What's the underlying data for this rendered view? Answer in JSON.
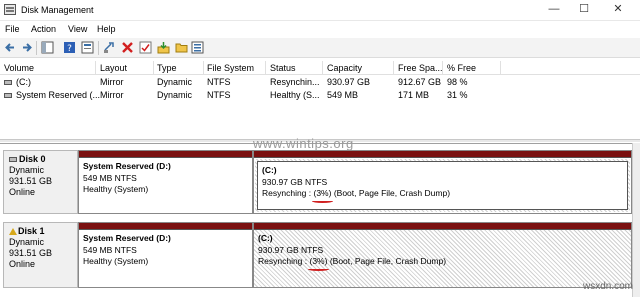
{
  "window": {
    "title": "Disk Management",
    "controls": {
      "minimize": "—",
      "maximize": "☐",
      "close": "✕"
    }
  },
  "menu": [
    "File",
    "Action",
    "View",
    "Help"
  ],
  "toolbar": [
    "back-icon",
    "forward-icon",
    "console-tree-icon",
    "help-icon",
    "properties-icon",
    "connect-icon",
    "delete-icon",
    "check-icon",
    "import-icon",
    "folder-icon",
    "list-icon"
  ],
  "volumes": {
    "columns": [
      "Volume",
      "Layout",
      "Type",
      "File System",
      "Status",
      "Capacity",
      "Free Spa...",
      "% Free"
    ],
    "rows": [
      [
        "(C:)",
        "Mirror",
        "Dynamic",
        "NTFS",
        "Resynchin...",
        "930.97 GB",
        "912.67 GB",
        "98 %"
      ],
      [
        "System Reserved (...",
        "Mirror",
        "Dynamic",
        "NTFS",
        "Healthy (S...",
        "549 MB",
        "171 MB",
        "31 %"
      ]
    ]
  },
  "watermark": "www.wintips.org",
  "disks": [
    {
      "name": "Disk 0",
      "type": "Dynamic",
      "size": "931.51 GB",
      "state": "Online",
      "warning": false,
      "partitions": [
        {
          "title": "System Reserved  (D:)",
          "line1": "549 MB NTFS",
          "line2": "Healthy (System)"
        },
        {
          "title": "(C:)",
          "line1": "930.97 GB NTFS",
          "line2_prefix": "Resynching : ",
          "line2_mark": "(3%)",
          "line2_suffix": " (Boot, Page File, Crash Dump)"
        }
      ]
    },
    {
      "name": "Disk 1",
      "type": "Dynamic",
      "size": "931.51 GB",
      "state": "Online",
      "warning": true,
      "partitions": [
        {
          "title": "System Reserved  (D:)",
          "line1": "549 MB NTFS",
          "line2": "Healthy (System)"
        },
        {
          "title": "(C:)",
          "line1": "930.97 GB NTFS",
          "line2_prefix": "Resynching : ",
          "line2_mark": "(3%)",
          "line2_suffix": " (Boot, Page File, Crash Dump)"
        }
      ]
    }
  ],
  "corner_tag": "wsxdn.com",
  "colors": {
    "partition_bar": "#7a1010",
    "annotation": "#d02020"
  }
}
